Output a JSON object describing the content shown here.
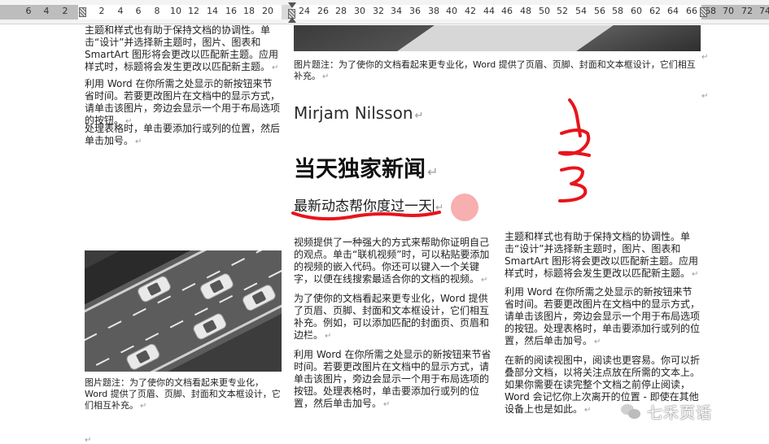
{
  "ruler": {
    "numbers": [
      "6",
      "4",
      "2",
      "2",
      "4",
      "6",
      "8",
      "10",
      "12",
      "14",
      "16",
      "18",
      "20",
      "24",
      "26",
      "28",
      "30",
      "32",
      "34",
      "36",
      "38",
      "40",
      "42",
      "44",
      "46",
      "48",
      "50",
      "52",
      "54",
      "56",
      "58",
      "60",
      "62",
      "64",
      "66",
      "68",
      "70",
      "72",
      "74"
    ]
  },
  "left_column": {
    "para1": "主题和样式也有助于保持文档的协调性。单击“设计”并选择新主题时，图片、图表和 SmartArt 图形将会更改以匹配新主题。应用样式时，标题将会发生更改以匹配新主题。",
    "para2": "利用 Word 在你所需之处显示的新按钮来节省时间。若要更改图片在文档中的显示方式，请单击该图片，旁边会显示一个用于布局选项的按钮。",
    "para3": "处理表格时，单击要添加行或列的位置，然后单击加号。",
    "caption": "图片题注：为了使你的文档看起来更专业化，Word 提供了页眉、页脚、封面和文本框设计，它们相互补充。"
  },
  "middle_column": {
    "caption_top": "图片题注：为了使你的文档看起来更专业化，Word 提供了页眉、页脚、封面和文本框设计，它们相互补充。",
    "author": "Mirjam Nilsson",
    "headline": "当天独家新闻",
    "subhead": "最新动态帮你度过一天",
    "para1": "视频提供了一种强大的方式来帮助你证明自己的观点。单击“联机视频”时，可以粘贴要添加的视频的嵌入代码。你还可以键入一个关键字，以便在线搜索最适合你的文档的视频。",
    "para2": "为了使你的文档看起来更专业化，Word 提供了页眉、页脚、封面和文本框设计，它们相互补充。例如，可以添加匹配的封面页、页眉和边栏。",
    "para3": "利用 Word 在你所需之处显示的新按钮来节省时间。若要更改图片在文档中的显示方式，请单击该图片，旁边会显示一个用于布局选项的按钮。处理表格时，单击要添加行或列的位置，然后单击加号。"
  },
  "right_column": {
    "para1": "主题和样式也有助于保持文档的协调性。单击“设计”并选择新主题时，图片、图表和 SmartArt 图形将会更改以匹配新主题。应用样式时，标题将会发生更改以匹配新主题。",
    "para2": "利用 Word 在你所需之处显示的新按钮来节省时间。若要更改图片在文档中的显示方式，请单击该图片，旁边会显示一个用于布局选项的按钮。处理表格时，单击要添加行或列的位置，然后单击加号。",
    "para3": "在新的阅读视图中，阅读也更容易。你可以折叠部分文档，以将关注点放在所需的文本上。如果你需要在读完整个文档之前停止阅读，Word 会记忆你上次离开的位置 - 即使在其他设备上也是如此。"
  },
  "annotation": {
    "color": "#e8141c",
    "digits": [
      "1",
      "2",
      "3"
    ]
  },
  "paragraph_mark": "↵",
  "watermark": {
    "text": "七禾页话",
    "icon": "wechat-icon"
  }
}
